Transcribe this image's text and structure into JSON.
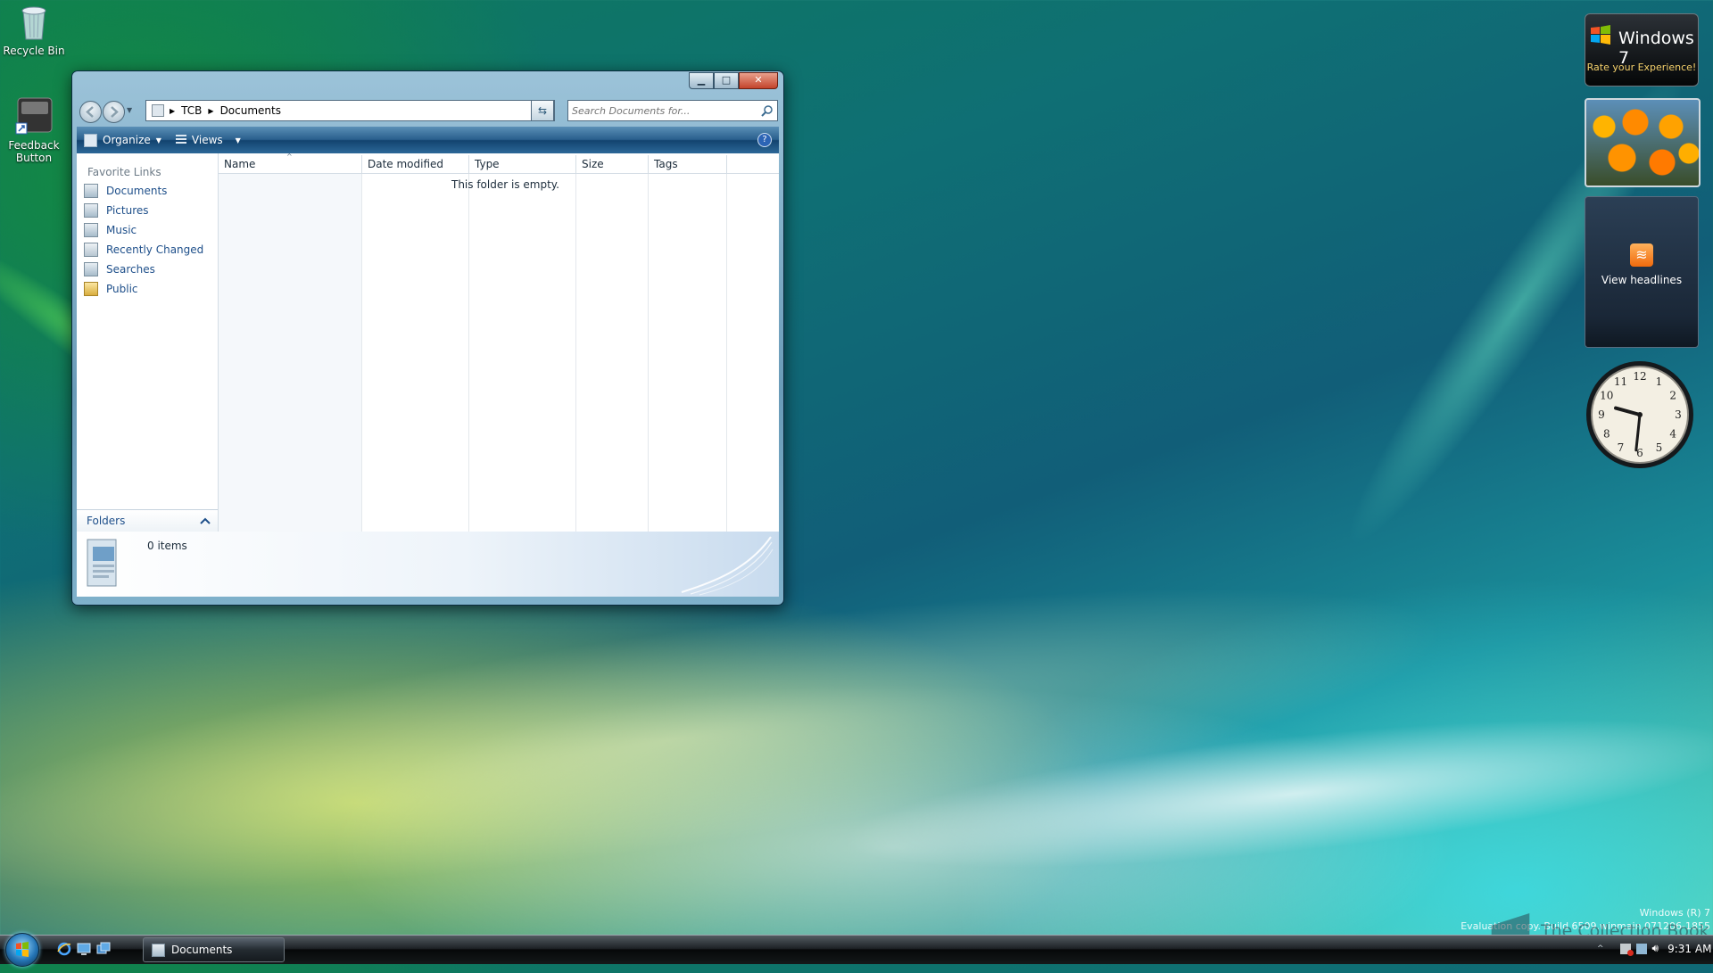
{
  "desktop": {
    "icons": [
      {
        "label": "Recycle Bin",
        "icon": "recycle-bin-icon"
      },
      {
        "label": "Feedback Button",
        "icon": "feedback-icon"
      }
    ],
    "watermark": {
      "line1": "Windows (R) 7",
      "line2": "Evaluation copy. Build 6509.winmain.071206-1855",
      "brand": "The Collection Book"
    }
  },
  "window": {
    "title": "Documents",
    "breadcrumb": [
      "TCB",
      "Documents"
    ],
    "search_placeholder": "Search Documents for...",
    "toolbar": {
      "organize": "Organize",
      "views": "Views",
      "help": "?"
    },
    "nav": {
      "favorite_title": "Favorite Links",
      "items": [
        {
          "label": "Documents",
          "icon": "documents-icon"
        },
        {
          "label": "Pictures",
          "icon": "pictures-icon"
        },
        {
          "label": "Music",
          "icon": "music-icon"
        },
        {
          "label": "Recently Changed",
          "icon": "recent-icon"
        },
        {
          "label": "Searches",
          "icon": "searches-icon"
        },
        {
          "label": "Public",
          "icon": "folder-icon"
        }
      ],
      "folders_label": "Folders"
    },
    "columns": [
      "Name",
      "Date modified",
      "Type",
      "Size",
      "Tags"
    ],
    "empty_message": "This folder is empty.",
    "details": {
      "item_count": "0 items"
    }
  },
  "gadgets": {
    "windows7": {
      "title": "Windows 7",
      "subtitle": "Rate your Experience!"
    },
    "feed": {
      "label": "View headlines"
    },
    "clock": {
      "hour": 9,
      "minute": 31,
      "numerals": [
        "12",
        "1",
        "2",
        "3",
        "4",
        "5",
        "6",
        "7",
        "8",
        "9",
        "10",
        "11"
      ]
    }
  },
  "taskbar": {
    "task_label": "Documents",
    "time": "9:31 AM"
  },
  "colors": {
    "accent": "#1e4f8a",
    "toolbar": "#2a5f8d"
  }
}
